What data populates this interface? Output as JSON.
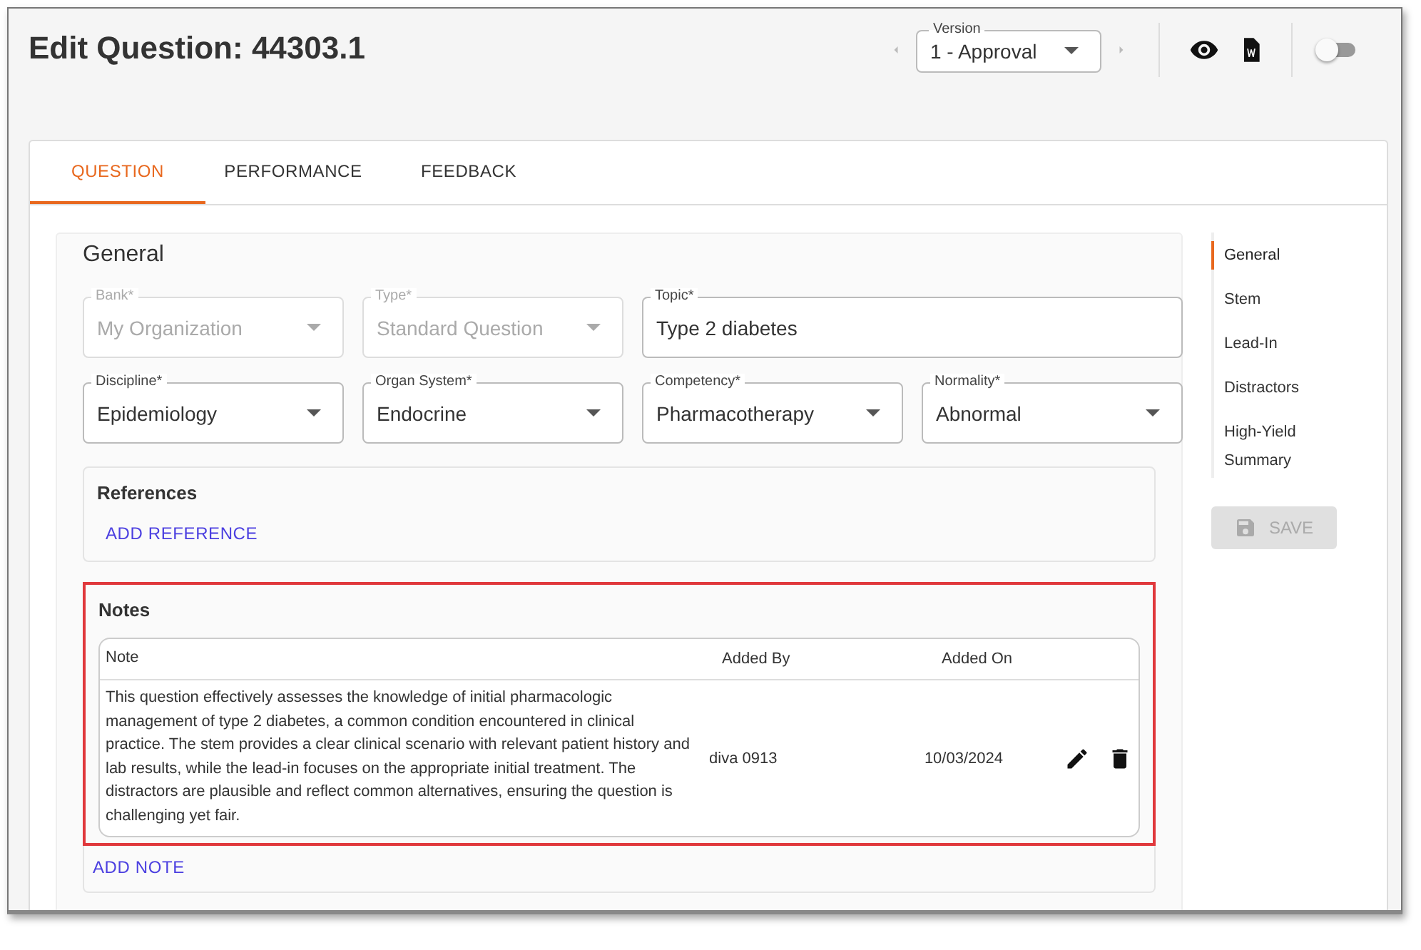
{
  "header": {
    "title": "Edit Question: 44303.1",
    "version": {
      "label": "Version",
      "value": "1 - Approval"
    },
    "toggle": {
      "on": false
    }
  },
  "tabs": [
    {
      "label": "QUESTION",
      "selected": true
    },
    {
      "label": "PERFORMANCE",
      "selected": false
    },
    {
      "label": "FEEDBACK",
      "selected": false
    }
  ],
  "general": {
    "title": "General",
    "fields": [
      {
        "kind": "select",
        "label": "Bank*",
        "value": "My Organization",
        "disabled": true
      },
      {
        "kind": "select",
        "label": "Type*",
        "value": "Standard Question",
        "disabled": true
      },
      {
        "kind": "text",
        "label": "Topic*",
        "value": "Type 2 diabetes",
        "disabled": false
      },
      {
        "kind": "select",
        "label": "Discipline*",
        "value": "Epidemiology",
        "disabled": false
      },
      {
        "kind": "select",
        "label": "Organ System*",
        "value": "Endocrine",
        "disabled": false
      },
      {
        "kind": "select",
        "label": "Competency*",
        "value": "Pharmacotherapy",
        "disabled": false
      },
      {
        "kind": "select",
        "label": "Normality*",
        "value": "Abnormal",
        "disabled": false
      }
    ]
  },
  "references": {
    "title": "References",
    "add_button": "ADD REFERENCE"
  },
  "notes": {
    "title": "Notes",
    "highlighted": true,
    "columns": [
      "Note",
      "Added By",
      "Added On"
    ],
    "rows": [
      {
        "note": "This question effectively assesses the knowledge of initial pharmacologic management of type 2 diabetes, a common condition encountered in clinical practice. The stem provides a clear clinical scenario with relevant patient history and lab results, while the lead-in focuses on the appropriate initial treatment. The distractors are plausible and reflect common alternatives, ensuring the question is challenging yet fair.",
        "added_by": "diva 0913",
        "added_on": "10/03/2024"
      }
    ],
    "add_button": "ADD NOTE"
  },
  "section_nav": [
    {
      "label": "General",
      "selected": true
    },
    {
      "label": "Stem",
      "selected": false
    },
    {
      "label": "Lead-In",
      "selected": false
    },
    {
      "label": "Distractors",
      "selected": false
    },
    {
      "label": "High-Yield Summary",
      "selected": false
    }
  ],
  "save_button": {
    "label": "SAVE",
    "disabled": true
  }
}
